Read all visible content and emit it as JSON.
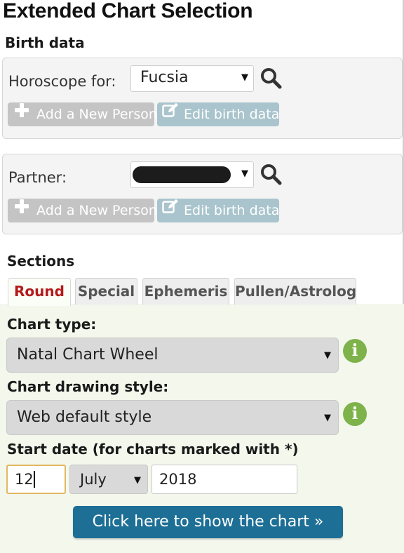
{
  "page": {
    "title": "Extended Chart Selection"
  },
  "birth_data": {
    "heading": "Birth data",
    "horoscope": {
      "label": "Horoscope for:",
      "selected": "Fucsia",
      "add_label": "Add a New Person",
      "edit_label": "Edit birth data"
    },
    "partner": {
      "label": "Partner:",
      "selected": "",
      "add_label": "Add a New Person",
      "edit_label": "Edit birth data"
    }
  },
  "sections": {
    "heading": "Sections",
    "tabs": [
      {
        "label": "Round",
        "active": true
      },
      {
        "label": "Special",
        "active": false
      },
      {
        "label": "Ephemeris",
        "active": false
      },
      {
        "label": "Pullen/Astrolog",
        "active": false
      }
    ]
  },
  "round": {
    "chart_type": {
      "label": "Chart type:",
      "selected": "Natal Chart Wheel",
      "info_icon": "info-icon"
    },
    "drawing_style": {
      "label": "Chart drawing style:",
      "selected": "Web default style",
      "info_icon": "info-icon"
    },
    "start_date": {
      "label": "Start date (for charts marked with *)",
      "day": "12",
      "month": "July",
      "year": "2018"
    },
    "submit_label": "Click here to show the chart »"
  },
  "icons": {
    "search": "search-icon",
    "add": "plus-icon",
    "edit": "edit-icon",
    "info": "info-icon",
    "caret": "caret-down-icon"
  },
  "colors": {
    "active_tab": "#b31b1b",
    "submit": "#1d6f96",
    "info": "#7eb24a",
    "focus": "#e2b862",
    "edit_button": "#a9c4cc",
    "add_button": "#c4c4c4"
  }
}
